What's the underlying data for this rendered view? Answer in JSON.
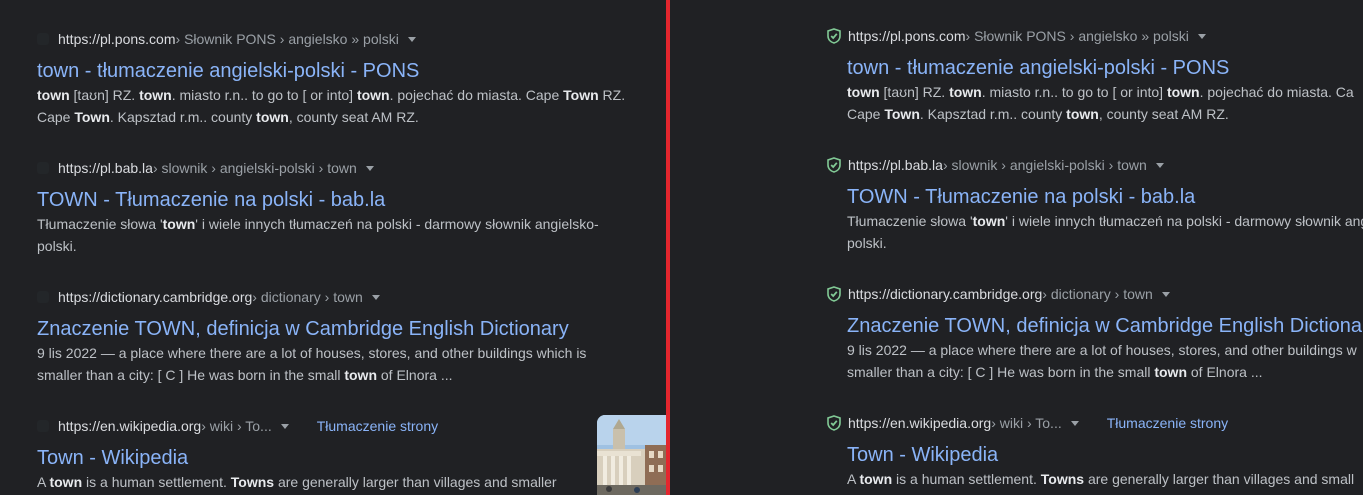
{
  "left": {
    "results": [
      {
        "domain": "https://pl.pons.com",
        "path": " › Słownik PONS › angielsko » polski",
        "title": "town - tłumaczenie angielski-polski - PONS",
        "snippet_lines": [
          [
            [
              "b",
              "town"
            ],
            [
              "t",
              " [taʊn] RZ. "
            ],
            [
              "b",
              "town"
            ],
            [
              "t",
              ". miasto r.n.. to go to [ or into] "
            ],
            [
              "b",
              "town"
            ],
            [
              "t",
              ". pojechać do miasta. Cape "
            ],
            [
              "b",
              "Town"
            ],
            [
              "t",
              " RZ."
            ]
          ],
          [
            [
              "t",
              "Cape "
            ],
            [
              "b",
              "Town"
            ],
            [
              "t",
              ". Kapsztad r.m.. county "
            ],
            [
              "b",
              "town"
            ],
            [
              "t",
              ", county seat AM RZ."
            ]
          ]
        ]
      },
      {
        "domain": "https://pl.bab.la",
        "path": " › slownik › angielski-polski › town",
        "title": "TOWN - Tłumaczenie na polski - bab.la",
        "snippet_lines": [
          [
            [
              "t",
              "Tłumaczenie słowa '"
            ],
            [
              "b",
              "town"
            ],
            [
              "t",
              "' i wiele innych tłumaczeń na polski - darmowy słownik angielsko-"
            ]
          ],
          [
            [
              "t",
              "polski."
            ]
          ]
        ]
      },
      {
        "domain": "https://dictionary.cambridge.org",
        "path": " › dictionary › town",
        "title": "Znaczenie TOWN, definicja w Cambridge English Dictionary",
        "snippet_lines": [
          [
            [
              "d",
              "9 lis 2022 — "
            ],
            [
              "t",
              "a place where there are a lot of houses, stores, and other buildings which is"
            ]
          ],
          [
            [
              "t",
              "smaller than a city: [ C ] He was born in the small "
            ],
            [
              "b",
              "town"
            ],
            [
              "t",
              " of Elnora ..."
            ]
          ]
        ]
      },
      {
        "domain": "https://en.wikipedia.org",
        "path": " › wiki › To...",
        "translate": "Tłumaczenie strony",
        "title": "Town - Wikipedia",
        "snippet_lines": [
          [
            [
              "t",
              "A "
            ],
            [
              "b",
              "town"
            ],
            [
              "t",
              " is a human settlement. "
            ],
            [
              "b",
              "Towns"
            ],
            [
              "t",
              " are generally larger than villages and smaller"
            ]
          ]
        ]
      }
    ]
  },
  "right": {
    "results": [
      {
        "domain": "https://pl.pons.com",
        "path": " › Słownik PONS › angielsko » polski",
        "title": "town - tłumaczenie angielski-polski - PONS",
        "snippet_lines": [
          [
            [
              "b",
              "town"
            ],
            [
              "t",
              " [taʊn] RZ. "
            ],
            [
              "b",
              "town"
            ],
            [
              "t",
              ". miasto r.n.. to go to [ or into] "
            ],
            [
              "b",
              "town"
            ],
            [
              "t",
              ". pojechać do miasta. Ca"
            ]
          ],
          [
            [
              "t",
              "Cape "
            ],
            [
              "b",
              "Town"
            ],
            [
              "t",
              ". Kapsztad r.m.. county "
            ],
            [
              "b",
              "town"
            ],
            [
              "t",
              ", county seat AM RZ."
            ]
          ]
        ]
      },
      {
        "domain": "https://pl.bab.la",
        "path": " › slownik › angielski-polski › town",
        "title": "TOWN - Tłumaczenie na polski - bab.la",
        "snippet_lines": [
          [
            [
              "t",
              "Tłumaczenie słowa '"
            ],
            [
              "b",
              "town"
            ],
            [
              "t",
              "' i wiele innych tłumaczeń na polski - darmowy słownik ang"
            ]
          ],
          [
            [
              "t",
              "polski."
            ]
          ]
        ]
      },
      {
        "domain": "https://dictionary.cambridge.org",
        "path": " › dictionary › town",
        "title": "Znaczenie TOWN, definicja w Cambridge English Dictiona",
        "snippet_lines": [
          [
            [
              "d",
              "9 lis 2022 — "
            ],
            [
              "t",
              "a place where there are a lot of houses, stores, and other buildings w"
            ]
          ],
          [
            [
              "t",
              "smaller than a city: [ C ] He was born in the small "
            ],
            [
              "b",
              "town"
            ],
            [
              "t",
              " of Elnora ..."
            ]
          ]
        ]
      },
      {
        "domain": "https://en.wikipedia.org",
        "path": " › wiki › To...",
        "translate": "Tłumaczenie strony",
        "title": "Town - Wikipedia",
        "snippet_lines": [
          [
            [
              "t",
              "A "
            ],
            [
              "b",
              "town"
            ],
            [
              "t",
              " is a human settlement. "
            ],
            [
              "b",
              "Towns"
            ],
            [
              "t",
              " are generally larger than villages and small"
            ]
          ]
        ]
      }
    ]
  },
  "colors": {
    "background": "#202124",
    "link": "#8ab4f8",
    "divider": "#e3262e",
    "shield": "#81c995"
  }
}
